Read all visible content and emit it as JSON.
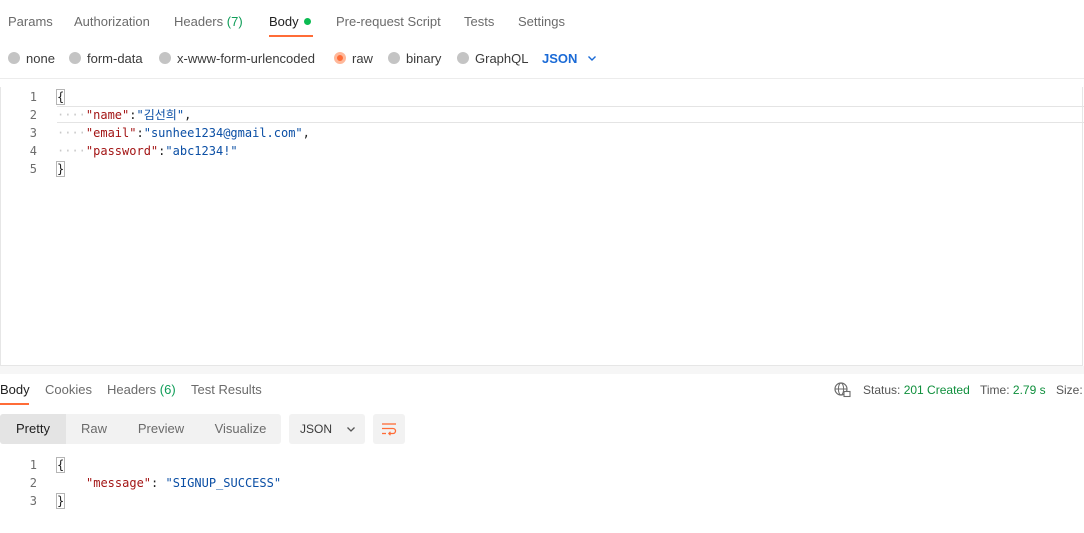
{
  "request_tabs": {
    "params": "Params",
    "authorization": "Authorization",
    "headers_label": "Headers",
    "headers_count": "(7)",
    "body": "Body",
    "prerequest": "Pre-request Script",
    "tests": "Tests",
    "settings": "Settings"
  },
  "body_types": {
    "none": "none",
    "form_data": "form-data",
    "urlencoded": "x-www-form-urlencoded",
    "raw": "raw",
    "binary": "binary",
    "graphql": "GraphQL",
    "selected": "raw",
    "language": "JSON"
  },
  "request_body": {
    "lines": [
      {
        "num": "1",
        "open": "{"
      },
      {
        "num": "2",
        "indent": "····",
        "key": "\"name\"",
        "sep": ":",
        "value": "\"김선희\"",
        "tail": ","
      },
      {
        "num": "3",
        "indent": "····",
        "key": "\"email\"",
        "sep": ":",
        "value": "\"sunhee1234@gmail.com\"",
        "tail": ","
      },
      {
        "num": "4",
        "indent": "····",
        "key": "\"password\"",
        "sep": ":",
        "value": "\"abc1234!\"",
        "tail": ""
      },
      {
        "num": "5",
        "close": "}"
      }
    ]
  },
  "response_tabs": {
    "body": "Body",
    "cookies": "Cookies",
    "headers_label": "Headers",
    "headers_count": "(6)",
    "test_results": "Test Results"
  },
  "response_status": {
    "status_label": "Status:",
    "status_value": "201 Created",
    "time_label": "Time:",
    "time_value": "2.79 s",
    "size_label": "Size:"
  },
  "response_view": {
    "pretty": "Pretty",
    "raw": "Raw",
    "preview": "Preview",
    "visualize": "Visualize",
    "format": "JSON"
  },
  "response_body": {
    "lines": [
      {
        "num": "1",
        "open": "{"
      },
      {
        "num": "2",
        "key": "\"message\"",
        "sep": ": ",
        "value": "\"SIGNUP_SUCCESS\""
      },
      {
        "num": "3",
        "close": "}"
      }
    ]
  },
  "colors": {
    "accent": "#ff6c37",
    "json_blue": "#1a6ad6",
    "success_green": "#0f8f3c"
  },
  "icons": [
    "green-dot-icon",
    "chevron-down-icon",
    "globe-network-icon",
    "wrap-lines-icon"
  ]
}
